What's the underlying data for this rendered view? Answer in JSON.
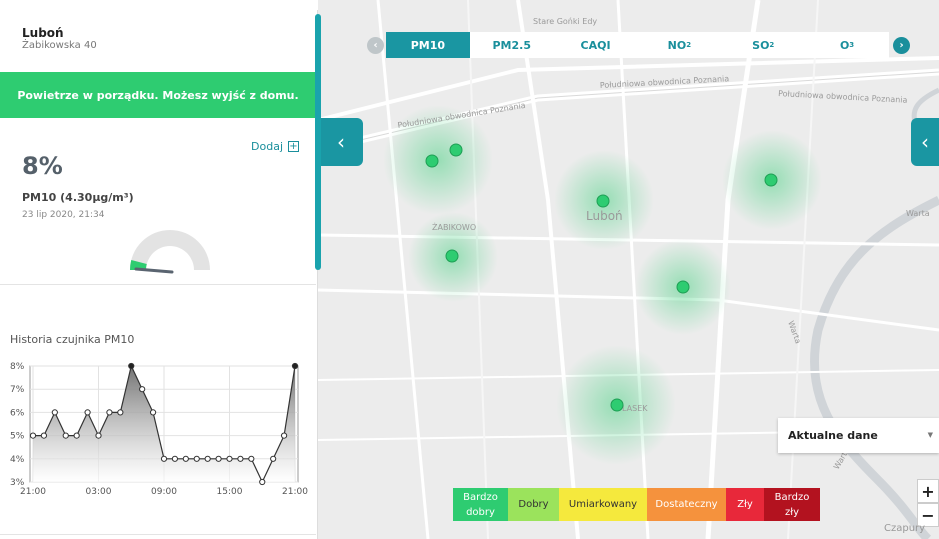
{
  "location": {
    "name": "Luboń",
    "street": "Żabikowska 40"
  },
  "status_message": "Powietrze w porządku. Możesz wyjść z domu.",
  "add_label": "Dodaj",
  "reading": {
    "percent": "8%",
    "pm_label": "PM10 (4.30µg/m³)",
    "date": "23 lip 2020, 21:34",
    "gauge_fraction": 0.08
  },
  "history_title": "Historia czujnika PM10",
  "chart_data": {
    "type": "area",
    "y_ticks": [
      "8%",
      "7%",
      "6%",
      "5%",
      "4%",
      "3%"
    ],
    "x_ticks": [
      "21:00",
      "03:00",
      "09:00",
      "15:00",
      "21:00"
    ],
    "ylim": [
      3,
      8
    ],
    "values": [
      5,
      5,
      6,
      5,
      5,
      6,
      5,
      6,
      6,
      8,
      7,
      6,
      4,
      4,
      4,
      4,
      4,
      4,
      4,
      4,
      4,
      3,
      4,
      5,
      8
    ]
  },
  "tabs": [
    {
      "label": "PM10",
      "sub": "",
      "active": true
    },
    {
      "label": "PM2.5",
      "sub": "",
      "active": false
    },
    {
      "label": "CAQI",
      "sub": "",
      "active": false
    },
    {
      "label": "NO",
      "sub": "2",
      "active": false
    },
    {
      "label": "SO",
      "sub": "2",
      "active": false
    },
    {
      "label": "O",
      "sub": "3",
      "active": false
    }
  ],
  "map": {
    "road_top": "Stare Gońki Edy",
    "road1": "Południowa obwodnica Poznania",
    "road2": "Południowa obwodnica Poznania",
    "road3": "Południowa obwodnica Poznania",
    "town_lubon": "Luboń",
    "town_zabikowo": "ŻABIKOWO",
    "town_lasek": "LASEK",
    "river1": "Warta",
    "river2": "Warta",
    "river3": "Warta"
  },
  "dropdown_label": "Aktualne dane",
  "legend": [
    {
      "label": "Bardzo dobry",
      "color": "#2ecc71",
      "text": "#ffffff",
      "width": 55
    },
    {
      "label": "Dobry",
      "color": "#9be35c",
      "text": "#333333",
      "width": 51
    },
    {
      "label": "Umiarkowany",
      "color": "#f5e93d",
      "text": "#333333",
      "width": 88
    },
    {
      "label": "Dostateczny",
      "color": "#f5923d",
      "text": "#ffffff",
      "width": 79
    },
    {
      "label": "Zły",
      "color": "#e8283a",
      "text": "#ffffff",
      "width": 38
    },
    {
      "label": "Bardzo zły",
      "color": "#b3121f",
      "text": "#ffffff",
      "width": 56
    }
  ],
  "zoom_in": "+",
  "zoom_out": "−",
  "attribution": "Czapury",
  "colors": {
    "accent": "#1a96a2",
    "good": "#2ecc71"
  }
}
